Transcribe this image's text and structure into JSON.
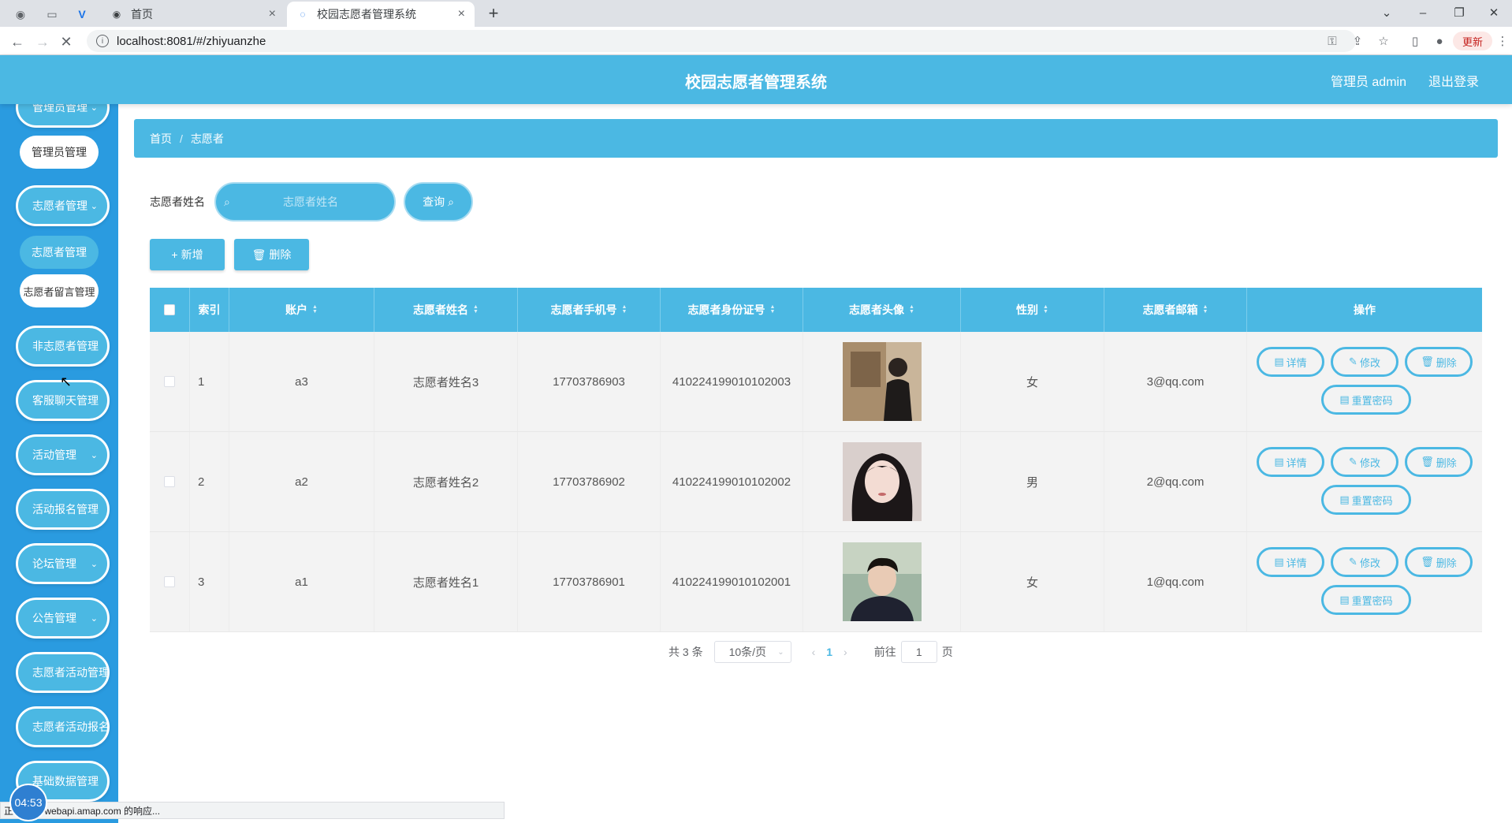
{
  "browser": {
    "tabs": [
      {
        "title": "首页",
        "active": false
      },
      {
        "title": "校园志愿者管理系统",
        "active": true
      }
    ],
    "url": "localhost:8081/#/zhiyuanzhe",
    "update_label": "更新",
    "status_text": "正在等待 webapi.amap.com 的响应...",
    "clock": "04:53"
  },
  "header": {
    "title": "校园志愿者管理系统",
    "user": "管理员 admin",
    "logout": "退出登录"
  },
  "sidebar": {
    "items": [
      {
        "label": "管理员管理",
        "type": "menu"
      },
      {
        "label": "管理员管理",
        "type": "sub",
        "active": true
      },
      {
        "label": "志愿者管理",
        "type": "menu"
      },
      {
        "label": "志愿者管理",
        "type": "sub"
      },
      {
        "label": "志愿者留言管理",
        "type": "sub",
        "active": true
      },
      {
        "label": "非志愿者管理",
        "type": "menu"
      },
      {
        "label": "客服聊天管理",
        "type": "menu"
      },
      {
        "label": "活动管理",
        "type": "menu"
      },
      {
        "label": "活动报名管理",
        "type": "menu"
      },
      {
        "label": "论坛管理",
        "type": "menu"
      },
      {
        "label": "公告管理",
        "type": "menu"
      },
      {
        "label": "志愿者活动管理",
        "type": "menu"
      },
      {
        "label": "志愿者活动报名管理",
        "type": "menu"
      },
      {
        "label": "基础数据管理",
        "type": "menu"
      }
    ]
  },
  "breadcrumb": {
    "home": "首页",
    "current": "志愿者"
  },
  "search": {
    "label": "志愿者姓名",
    "placeholder": "志愿者姓名",
    "query_label": "查询"
  },
  "actions": {
    "add_label": "新增",
    "delete_label": "删除"
  },
  "table": {
    "headers": [
      "索引",
      "账户",
      "志愿者姓名",
      "志愿者手机号",
      "志愿者身份证号",
      "志愿者头像",
      "性别",
      "志愿者邮箱",
      "操作"
    ],
    "rows": [
      {
        "index": "1",
        "account": "a3",
        "name": "志愿者姓名3",
        "phone": "17703786903",
        "idcard": "410224199010102003",
        "gender": "女",
        "email": "3@qq.com"
      },
      {
        "index": "2",
        "account": "a2",
        "name": "志愿者姓名2",
        "phone": "17703786902",
        "idcard": "410224199010102002",
        "gender": "男",
        "email": "2@qq.com"
      },
      {
        "index": "3",
        "account": "a1",
        "name": "志愿者姓名1",
        "phone": "17703786901",
        "idcard": "410224199010102001",
        "gender": "女",
        "email": "1@qq.com"
      }
    ],
    "op_labels": {
      "detail": "详情",
      "edit": "修改",
      "delete": "删除",
      "reset": "重置密码"
    }
  },
  "pagination": {
    "total": "共 3 条",
    "page_size": "10条/页",
    "current": "1",
    "goto_prefix": "前往",
    "goto_value": "1",
    "goto_suffix": "页"
  },
  "colors": {
    "primary": "#4bb8e3",
    "sidebar": "#2a9be0"
  }
}
